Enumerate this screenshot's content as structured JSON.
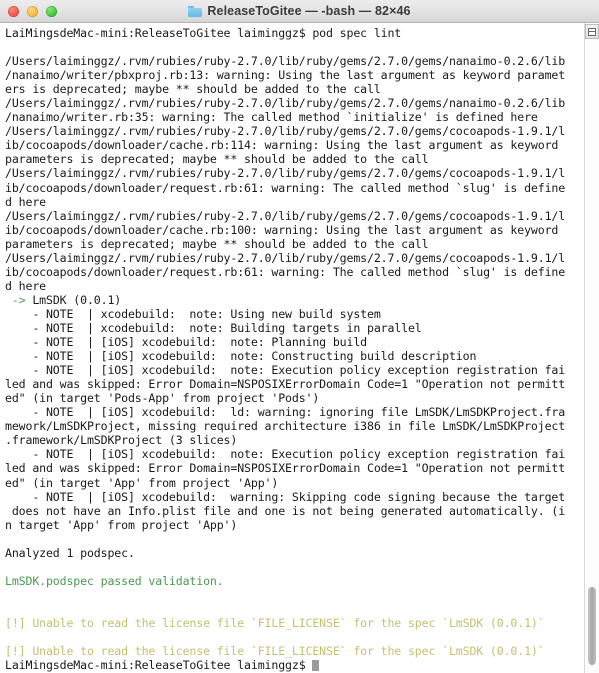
{
  "window": {
    "title": "ReleaseToGitee — -bash — 82×46",
    "folder_icon": "folder-icon",
    "controls": {
      "close_label": "close",
      "minimize_label": "minimize",
      "maximize_label": "maximize"
    }
  },
  "colors": {
    "background": "#ffffff",
    "foreground": "#1a1a1a",
    "green": "#4e9a52",
    "yellow": "#c4c171",
    "titlebar": "#e4e4e4"
  },
  "terminal": {
    "cols": 82,
    "rows": 46,
    "shell": "-bash",
    "prompt": "LaiMingsdeMac-mini:ReleaseToGitee laiminggz$",
    "command": "pod spec lint",
    "lines": [
      {
        "text": "LaiMingsdeMac-mini:ReleaseToGitee laiminggz$ pod spec lint",
        "color": "white"
      },
      {
        "text": "",
        "color": "white"
      },
      {
        "text": "/Users/laiminggz/.rvm/rubies/ruby-2.7.0/lib/ruby/gems/2.7.0/gems/nanaimo-0.2.6/lib",
        "color": "white"
      },
      {
        "text": "/nanaimo/writer/pbxproj.rb:13: warning: Using the last argument as keyword paramet",
        "color": "white"
      },
      {
        "text": "ers is deprecated; maybe ** should be added to the call",
        "color": "white"
      },
      {
        "text": "/Users/laiminggz/.rvm/rubies/ruby-2.7.0/lib/ruby/gems/2.7.0/gems/nanaimo-0.2.6/lib",
        "color": "white"
      },
      {
        "text": "/nanaimo/writer.rb:35: warning: The called method `initialize' is defined here",
        "color": "white"
      },
      {
        "text": "/Users/laiminggz/.rvm/rubies/ruby-2.7.0/lib/ruby/gems/2.7.0/gems/cocoapods-1.9.1/l",
        "color": "white"
      },
      {
        "text": "ib/cocoapods/downloader/cache.rb:114: warning: Using the last argument as keyword",
        "color": "white"
      },
      {
        "text": "parameters is deprecated; maybe ** should be added to the call",
        "color": "white"
      },
      {
        "text": "/Users/laiminggz/.rvm/rubies/ruby-2.7.0/lib/ruby/gems/2.7.0/gems/cocoapods-1.9.1/l",
        "color": "white"
      },
      {
        "text": "ib/cocoapods/downloader/request.rb:61: warning: The called method `slug' is define",
        "color": "white"
      },
      {
        "text": "d here",
        "color": "white"
      },
      {
        "text": "/Users/laiminggz/.rvm/rubies/ruby-2.7.0/lib/ruby/gems/2.7.0/gems/cocoapods-1.9.1/l",
        "color": "white"
      },
      {
        "text": "ib/cocoapods/downloader/cache.rb:100: warning: Using the last argument as keyword",
        "color": "white"
      },
      {
        "text": "parameters is deprecated; maybe ** should be added to the call",
        "color": "white"
      },
      {
        "text": "/Users/laiminggz/.rvm/rubies/ruby-2.7.0/lib/ruby/gems/2.7.0/gems/cocoapods-1.9.1/l",
        "color": "white"
      },
      {
        "text": "ib/cocoapods/downloader/request.rb:61: warning: The called method `slug' is define",
        "color": "white"
      },
      {
        "text": "d here",
        "color": "white"
      },
      {
        "segments": [
          {
            "text": " -> ",
            "color": "green"
          },
          {
            "text": "LmSDK (0.0.1)",
            "color": "white"
          }
        ]
      },
      {
        "text": "    - NOTE  | xcodebuild:  note: Using new build system",
        "color": "white"
      },
      {
        "text": "    - NOTE  | xcodebuild:  note: Building targets in parallel",
        "color": "white"
      },
      {
        "text": "    - NOTE  | [iOS] xcodebuild:  note: Planning build",
        "color": "white"
      },
      {
        "text": "    - NOTE  | [iOS] xcodebuild:  note: Constructing build description",
        "color": "white"
      },
      {
        "text": "    - NOTE  | [iOS] xcodebuild:  note: Execution policy exception registration fai",
        "color": "white"
      },
      {
        "text": "led and was skipped: Error Domain=NSPOSIXErrorDomain Code=1 \"Operation not permitt",
        "color": "white"
      },
      {
        "text": "ed\" (in target 'Pods-App' from project 'Pods')",
        "color": "white"
      },
      {
        "text": "    - NOTE  | [iOS] xcodebuild:  ld: warning: ignoring file LmSDK/LmSDKProject.fra",
        "color": "white"
      },
      {
        "text": "mework/LmSDKProject, missing required architecture i386 in file LmSDK/LmSDKProject",
        "color": "white"
      },
      {
        "text": ".framework/LmSDKProject (3 slices)",
        "color": "white"
      },
      {
        "text": "    - NOTE  | [iOS] xcodebuild:  note: Execution policy exception registration fai",
        "color": "white"
      },
      {
        "text": "led and was skipped: Error Domain=NSPOSIXErrorDomain Code=1 \"Operation not permitt",
        "color": "white"
      },
      {
        "text": "ed\" (in target 'App' from project 'App')",
        "color": "white"
      },
      {
        "text": "    - NOTE  | [iOS] xcodebuild:  warning: Skipping code signing because the target",
        "color": "white"
      },
      {
        "text": " does not have an Info.plist file and one is not being generated automatically. (i",
        "color": "white"
      },
      {
        "text": "n target 'App' from project 'App')",
        "color": "white"
      },
      {
        "text": "",
        "color": "white"
      },
      {
        "text": "Analyzed 1 podspec.",
        "color": "white"
      },
      {
        "text": "",
        "color": "white"
      },
      {
        "text": "LmSDK.podspec passed validation.",
        "color": "green"
      },
      {
        "text": "",
        "color": "white"
      },
      {
        "text": "",
        "color": "white"
      },
      {
        "text": "[!] Unable to read the license file `FILE_LICENSE` for the spec `LmSDK (0.0.1)`",
        "color": "yellow"
      },
      {
        "text": "",
        "color": "white"
      },
      {
        "text": "[!] Unable to read the license file `FILE_LICENSE` for the spec `LmSDK (0.0.1)`",
        "color": "yellow"
      },
      {
        "segments": [
          {
            "text": "LaiMingsdeMac-mini:ReleaseToGitee laiminggz$ ",
            "color": "white"
          },
          {
            "text": "",
            "color": "white",
            "cursor": true
          }
        ]
      }
    ]
  },
  "scrollbar": {
    "split_button_label": "split-pane",
    "thumb_position_percent": 88
  }
}
